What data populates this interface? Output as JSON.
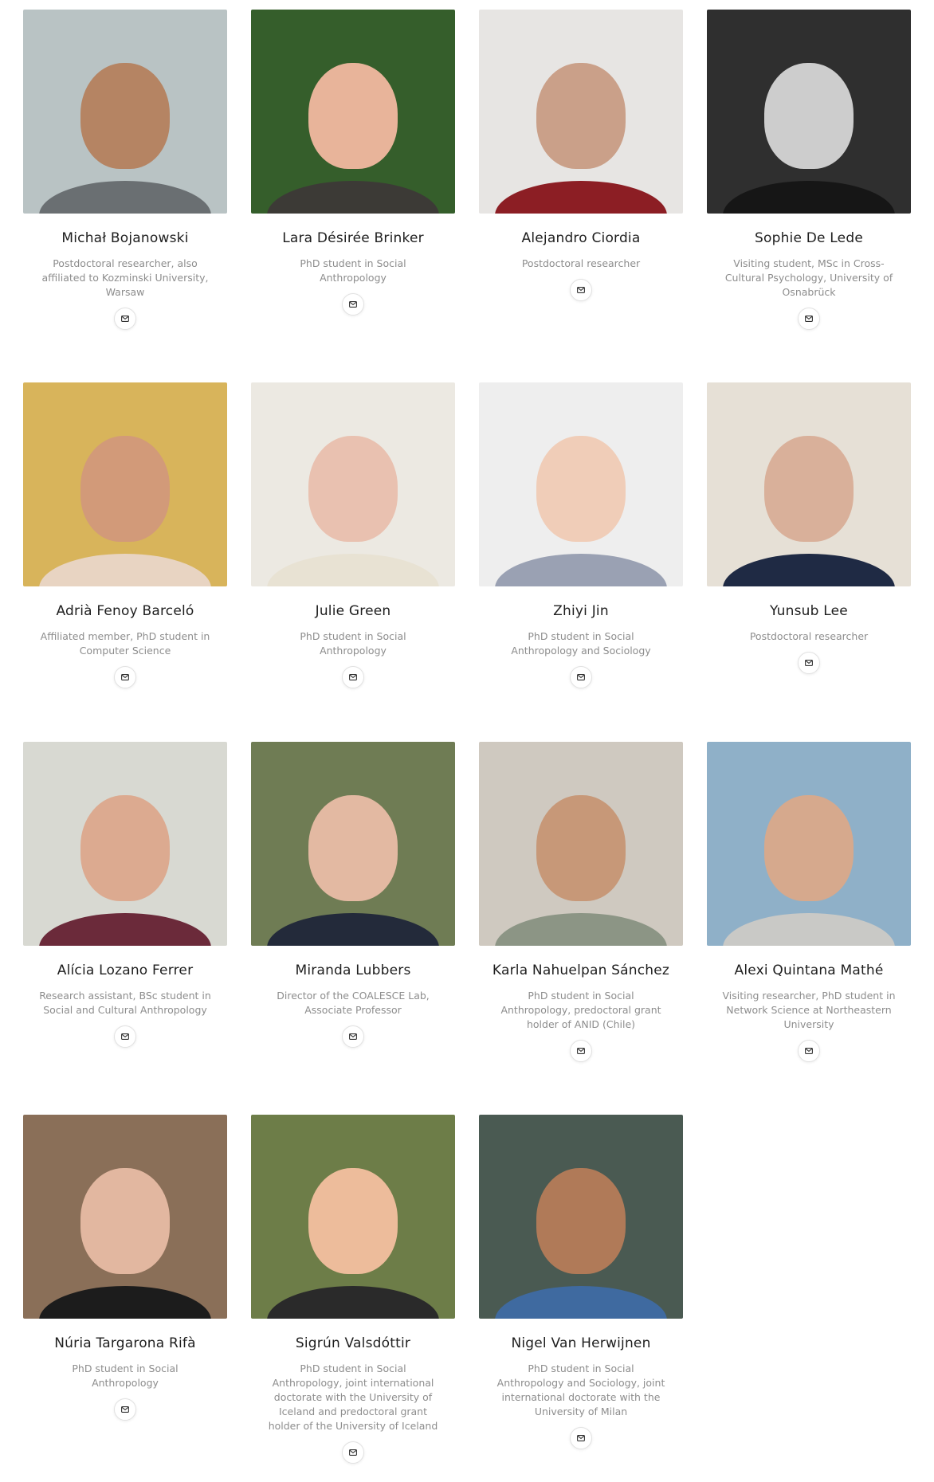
{
  "members": [
    {
      "name": "Michał Bojanowski",
      "role": "Postdoctoral researcher, also affiliated to Kozminski University, Warsaw",
      "bg": "#b9c3c4",
      "skin": "#b58463",
      "cloth": "#6a6f72"
    },
    {
      "name": "Lara Désirée Brinker",
      "role": "PhD student in Social Anthropology",
      "bg": "#355e2b",
      "skin": "#e8b49a",
      "cloth": "#3c3a36"
    },
    {
      "name": "Alejandro Ciordia",
      "role": "Postdoctoral researcher",
      "bg": "#e7e5e3",
      "skin": "#caa089",
      "cloth": "#8c1e24"
    },
    {
      "name": "Sophie De Lede",
      "role": "Visiting student, MSc in Cross-Cultural Psychology, University of Osnabrück",
      "bg": "#2f2f2f",
      "skin": "#cdcdcd",
      "cloth": "#161616"
    },
    {
      "name": "Adrià Fenoy Barceló",
      "role": "Affiliated member, PhD student in Computer Science",
      "bg": "#d8b45b",
      "skin": "#d29a79",
      "cloth": "#e8d4c2"
    },
    {
      "name": "Julie Green",
      "role": "PhD student in Social Anthropology",
      "bg": "#ece9e2",
      "skin": "#e9c1b0",
      "cloth": "#e8e2d3"
    },
    {
      "name": "Zhiyi Jin",
      "role": "PhD student in Social Anthropology and Sociology",
      "bg": "#eeeeee",
      "skin": "#f0cdb8",
      "cloth": "#9aa1b3"
    },
    {
      "name": "Yunsub Lee",
      "role": "Postdoctoral researcher",
      "bg": "#e6e0d6",
      "skin": "#d9b09a",
      "cloth": "#1f2a44"
    },
    {
      "name": "Alícia Lozano Ferrer",
      "role": "Research assistant, BSc student in Social and Cultural Anthropology",
      "bg": "#d8d9d2",
      "skin": "#dcaa90",
      "cloth": "#6b2a3a"
    },
    {
      "name": "Miranda Lubbers",
      "role": "Director of the COALESCE Lab, Associate Professor",
      "bg": "#6f7c54",
      "skin": "#e3b9a2",
      "cloth": "#232a3a"
    },
    {
      "name": "Karla Nahuelpan Sánchez",
      "role": "PhD student in Social Anthropology, predoctoral grant holder of ANID (Chile)",
      "bg": "#cfc9c0",
      "skin": "#c79878",
      "cloth": "#8c9585"
    },
    {
      "name": "Alexi Quintana Mathé",
      "role": "Visiting researcher, PhD student in Network Science at Northeastern University",
      "bg": "#8fb0c8",
      "skin": "#d6a98d",
      "cloth": "#c9c9c6"
    },
    {
      "name": "Núria Targarona Rifà",
      "role": "PhD student in Social Anthropology",
      "bg": "#8a6f58",
      "skin": "#e2b7a0",
      "cloth": "#1c1c1c"
    },
    {
      "name": "Sigrún Valsdóttir",
      "role": "PhD student in Social Anthropology, joint international doctorate with the University of Iceland and predoctoral grant holder of the University of Iceland",
      "bg": "#6d7d48",
      "skin": "#edbc9b",
      "cloth": "#2a2a2a"
    },
    {
      "name": "Nigel Van Herwijnen",
      "role": "PhD student in Social Anthropology and Sociology, joint international doctorate with the University of Milan",
      "bg": "#4a5a52",
      "skin": "#b07a58",
      "cloth": "#3f6aa0"
    }
  ]
}
